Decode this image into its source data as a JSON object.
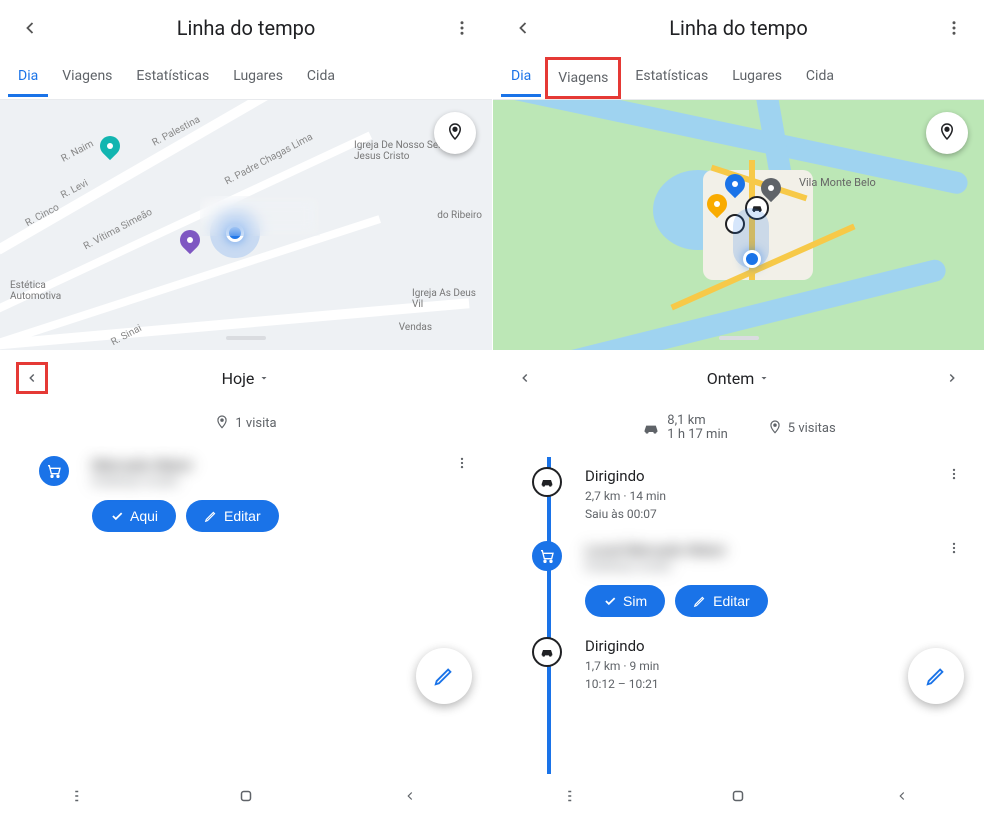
{
  "left": {
    "header": {
      "title": "Linha do tempo"
    },
    "tabs": [
      "Dia",
      "Viagens",
      "Estatísticas",
      "Lugares",
      "Cida"
    ],
    "activeTabIndex": 0,
    "map": {
      "streets": [
        "R. Naim",
        "R. Palestina",
        "R. Levi",
        "R. Cinco",
        "R. Padre Chagas Lima",
        "R. Vítima Simeão",
        "R. Sinai"
      ],
      "pois": [
        "Igreja De Nosso Senhor Jesus Cristo",
        "do Ribeiro",
        "Estética Automotiva",
        "Igreja As Deus Vil",
        "Vendas"
      ]
    },
    "datenav": {
      "label": "Hoje",
      "prevEnabled": true,
      "nextEnabled": false
    },
    "summary": {
      "visits": "1 visita"
    },
    "items": [
      {
        "type": "place",
        "icon": "cart",
        "title": "Mercado Maior",
        "subtitle": "Endereço oculto",
        "blurred": true,
        "buttons": [
          {
            "icon": "check",
            "label": "Aqui"
          },
          {
            "icon": "pencil",
            "label": "Editar"
          }
        ]
      }
    ]
  },
  "right": {
    "header": {
      "title": "Linha do tempo"
    },
    "tabs": [
      "Dia",
      "Viagens",
      "Estatísticas",
      "Lugares",
      "Cida"
    ],
    "activeTabIndex": 0,
    "highlightTabIndex": 1,
    "map": {
      "town": "Vila Monte Belo"
    },
    "datenav": {
      "label": "Ontem",
      "prevEnabled": true,
      "nextEnabled": true
    },
    "summary": {
      "drive": {
        "dist": "8,1 km",
        "time": "1 h 17 min"
      },
      "visits": "5 visitas"
    },
    "items": [
      {
        "type": "moving",
        "icon": "car",
        "title": "Dirigindo",
        "sub1": "2,7 km · 14 min",
        "sub2": "Saiu às 00:07"
      },
      {
        "type": "place",
        "icon": "cart",
        "title": "Local Mercado Maior",
        "subtitle": "Endereço oculto",
        "blurred": true,
        "buttons": [
          {
            "icon": "check",
            "label": "Sim"
          },
          {
            "icon": "pencil",
            "label": "Editar"
          }
        ]
      },
      {
        "type": "moving",
        "icon": "car",
        "title": "Dirigindo",
        "sub1": "1,7 km · 9 min",
        "sub2": "10:12 – 10:21"
      }
    ]
  }
}
